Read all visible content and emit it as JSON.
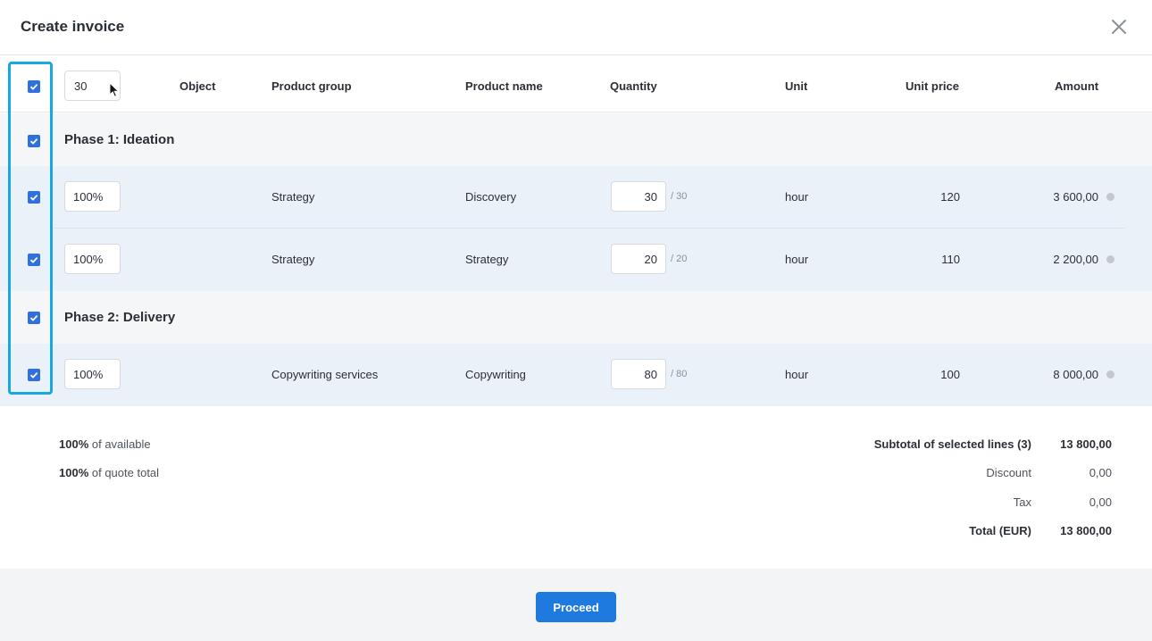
{
  "dialog": {
    "title": "Create invoice"
  },
  "header_row": {
    "percent_value": "30",
    "columns": {
      "object": "Object",
      "product_group": "Product group",
      "product_name": "Product name",
      "quantity": "Quantity",
      "unit": "Unit",
      "unit_price": "Unit price",
      "amount": "Amount"
    }
  },
  "phases": [
    {
      "title": "Phase 1: Ideation",
      "lines": [
        {
          "percent": "100%",
          "product_group": "Strategy",
          "product_name": "Discovery",
          "quantity": "30",
          "quantity_max": "/ 30",
          "unit": "hour",
          "unit_price": "120",
          "amount": "3 600,00"
        },
        {
          "percent": "100%",
          "product_group": "Strategy",
          "product_name": "Strategy",
          "quantity": "20",
          "quantity_max": "/ 20",
          "unit": "hour",
          "unit_price": "110",
          "amount": "2 200,00"
        }
      ]
    },
    {
      "title": "Phase 2: Delivery",
      "lines": [
        {
          "percent": "100%",
          "product_group": "Copywriting services",
          "product_name": "Copywriting",
          "quantity": "80",
          "quantity_max": "/ 80",
          "unit": "hour",
          "unit_price": "100",
          "amount": "8 000,00"
        }
      ]
    }
  ],
  "summary": {
    "available_pct": "100%",
    "available_text": "of available",
    "quote_pct": "100%",
    "quote_text": "of quote total",
    "subtotal_label": "Subtotal of selected lines (3)",
    "subtotal_value": "13 800,00",
    "discount_label": "Discount",
    "discount_value": "0,00",
    "tax_label": "Tax",
    "tax_value": "0,00",
    "total_label": "Total (EUR)",
    "total_value": "13 800,00"
  },
  "footer": {
    "proceed_label": "Proceed"
  },
  "colors": {
    "accent": "#1f7ae0",
    "checkbox": "#2f6fe0",
    "highlight": "#17a8e3",
    "line_row_bg": "#eaf1f9",
    "phase_row_bg": "#f5f6f8"
  },
  "icons": {
    "close": "close-icon",
    "check": "check-icon",
    "cursor": "mouse-pointer-icon"
  }
}
